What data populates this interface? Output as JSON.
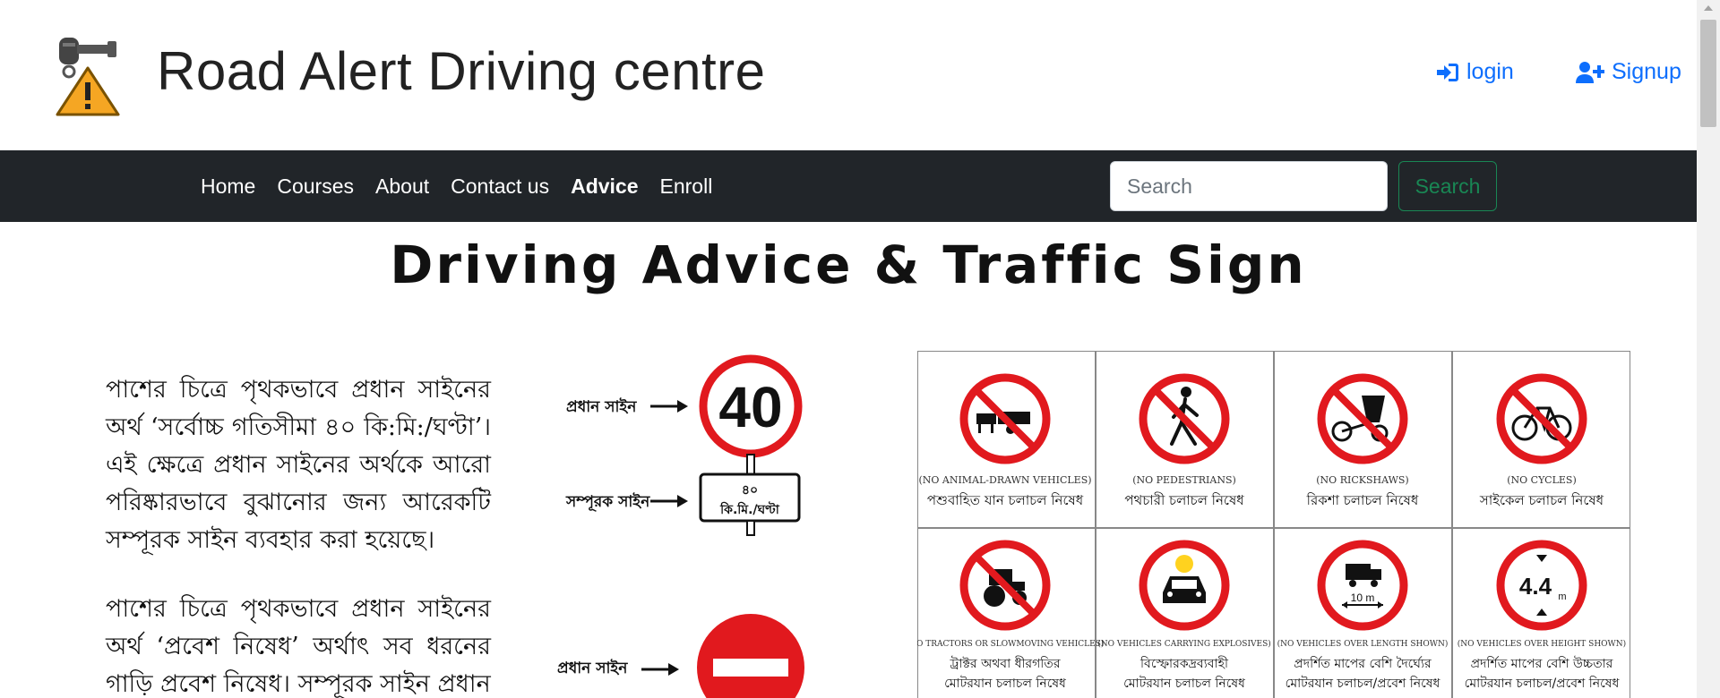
{
  "header": {
    "site_title": "Road Alert Driving centre",
    "login_label": "login",
    "signup_label": "Signup",
    "login_icon": "sign-in-icon",
    "signup_icon": "user-plus-icon",
    "logo_icon": "car-key-warning-logo"
  },
  "navbar": {
    "links": [
      "Home",
      "Courses",
      "About",
      "Contact us",
      "Advice",
      "Enroll"
    ],
    "active": "Advice",
    "search_placeholder": "Search",
    "search_button": "Search"
  },
  "content": {
    "heading": "Driving Advice & Traffic Sign",
    "paragraph1": "পাশের চিত্রে পৃথকভাবে প্রধান সাইনের অর্থ ‘সর্বোচ্চ গতিসীমা ৪০ কি:মি:/ঘণ্টা’। এই ক্ষেত্রে প্রধান সাইনের অর্থকে আরো পরিষ্কারভাবে বুঝানোর জন্য আরেকটি সম্পূরক সাইন ব্যবহার করা হয়েছে।",
    "paragraph2": "পাশের চিত্রে পৃথকভাবে প্রধান সাইনের অর্থ ‘প্রবেশ নিষেধ’ অর্থাৎ সব ধরনের গাড়ি প্রবেশ নিষেধ। সম্পূরক সাইন প্রধান",
    "diagram": {
      "main_sign_label": "প্রধান সাইন",
      "supplementary_sign_label": "সম্পূরক সাইন",
      "speed_value": "40",
      "plate_line1": "৪০",
      "plate_line2": "কি.মি./ঘণ্টা"
    },
    "signs": [
      {
        "icon": "no-animal-drawn-vehicles-icon",
        "en": "(NO ANIMAL-DRAWN VEHICLES)",
        "bn1": "পশুবাহিত যান চলাচল নিষেধ",
        "bn2": ""
      },
      {
        "icon": "no-pedestrians-icon",
        "en": "(NO PEDESTRIANS)",
        "bn1": "পথচারী চলাচল নিষেধ",
        "bn2": ""
      },
      {
        "icon": "no-rickshaws-icon",
        "en": "(NO RICKSHAWS)",
        "bn1": "রিকশা চলাচল নিষেধ",
        "bn2": ""
      },
      {
        "icon": "no-cycles-icon",
        "en": "(NO CYCLES)",
        "bn1": "সাইকেল চলাচল নিষেধ",
        "bn2": ""
      },
      {
        "icon": "no-tractors-icon",
        "en": "(NO TRACTORS OR SLOWMOVING VEHICLES)",
        "bn1": "ট্রাক্টর অথবা ধীরগতির",
        "bn2": "মোটরযান চলাচল নিষেধ"
      },
      {
        "icon": "no-explosives-icon",
        "en": "(NO VEHICLES CARRYING EXPLOSIVES)",
        "bn1": "বিস্ফোরকদ্রব্যবাহী",
        "bn2": "মোটরযান চলাচল নিষেধ"
      },
      {
        "icon": "no-long-vehicles-icon",
        "en": "(NO VEHICLES OVER LENGTH SHOWN)",
        "bn1": "প্রদর্শিত মাপের বেশি দৈর্ঘ্যের",
        "bn2": "মোটরযান চলাচল/প্রবেশ নিষেধ",
        "value": "10 m"
      },
      {
        "icon": "no-tall-vehicles-icon",
        "en": "(NO VEHICLES OVER HEIGHT SHOWN)",
        "bn1": "প্রদর্শিত মাপের বেশি উচ্চতার",
        "bn2": "মোটরযান চলাচল/প্রবেশ নিষেধ",
        "value": "4.4",
        "unit": "m"
      }
    ]
  },
  "colors": {
    "navbar_bg": "#212529",
    "link_blue": "#0d6efd",
    "search_green": "#198754",
    "sign_red": "#e1191e",
    "logo_orange": "#f5a623"
  }
}
